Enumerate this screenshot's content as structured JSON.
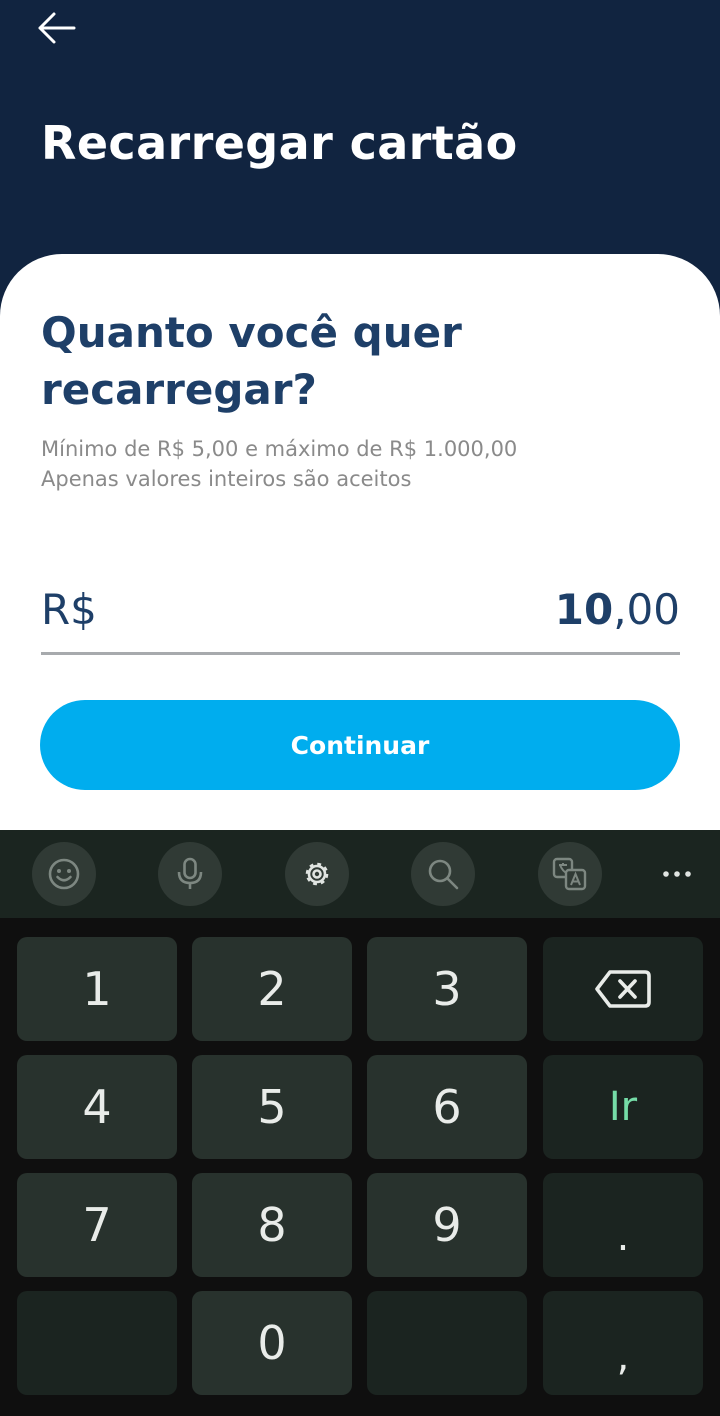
{
  "header": {
    "title": "Recarregar cartão",
    "back_icon": "arrow-left-icon"
  },
  "card": {
    "question": "Quanto você quer recarregar?",
    "hint_line1": "Mínimo de R$ 5,00 e máximo de R$ 1.000,00",
    "hint_line2": "Apenas valores inteiros são aceitos",
    "currency": "R$",
    "amount_integer": "10",
    "amount_decimal": ",00",
    "continue_label": "Continuar"
  },
  "keyboard": {
    "toolbar_icons": [
      "emoji-icon",
      "microphone-icon",
      "settings-icon",
      "search-icon",
      "translate-icon",
      "more-icon"
    ],
    "keys": {
      "k1": "1",
      "k2": "2",
      "k3": "3",
      "k4": "4",
      "k5": "5",
      "k6": "6",
      "k7": "7",
      "k8": "8",
      "k9": "9",
      "k0": "0",
      "go": "Ir",
      "period": ".",
      "comma": ","
    },
    "backspace_icon": "backspace-icon"
  },
  "colors": {
    "header_bg": "#112440",
    "title_text": "#1e3f68",
    "button_bg": "#00adee",
    "keyboard_bg": "#0f0f0f",
    "key_bg": "#28322d",
    "accent_key": "#75dca7"
  }
}
